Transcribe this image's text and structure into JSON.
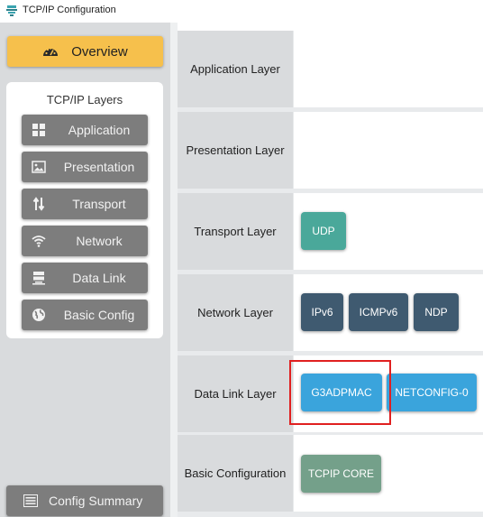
{
  "window": {
    "title": "TCP/IP Configuration"
  },
  "sidebar": {
    "overview_label": "Overview",
    "layers_title": "TCP/IP Layers",
    "items": [
      {
        "label": "Application",
        "icon": "grid-icon"
      },
      {
        "label": "Presentation",
        "icon": "image-icon"
      },
      {
        "label": "Transport",
        "icon": "arrows-updown-icon"
      },
      {
        "label": "Network",
        "icon": "wifi-icon"
      },
      {
        "label": "Data Link",
        "icon": "server-icon"
      },
      {
        "label": "Basic Config",
        "icon": "globe-icon"
      }
    ],
    "summary_label": "Config Summary"
  },
  "layers": [
    {
      "label": "Application Layer",
      "modules": []
    },
    {
      "label": "Presentation Layer",
      "modules": []
    },
    {
      "label": "Transport Layer",
      "modules": [
        {
          "label": "UDP",
          "color": "#4aa89a"
        }
      ]
    },
    {
      "label": "Network Layer",
      "modules": [
        {
          "label": "IPv6",
          "color": "#3f5a70"
        },
        {
          "label": "ICMPv6",
          "color": "#3f5a70"
        },
        {
          "label": "NDP",
          "color": "#3f5a70"
        }
      ]
    },
    {
      "label": "Data Link Layer",
      "modules": [
        {
          "label": "G3ADPMAC",
          "color": "#3aa4dc"
        },
        {
          "label": "NETCONFIG-0",
          "color": "#3aa4dc"
        }
      ]
    },
    {
      "label": "Basic Configuration",
      "modules": [
        {
          "label": "TCPIP CORE",
          "color": "#74a08a"
        }
      ]
    }
  ],
  "colors": {
    "overview": "#f6c04c",
    "nav_button": "#7d7d7d",
    "highlight": "#e02020"
  }
}
